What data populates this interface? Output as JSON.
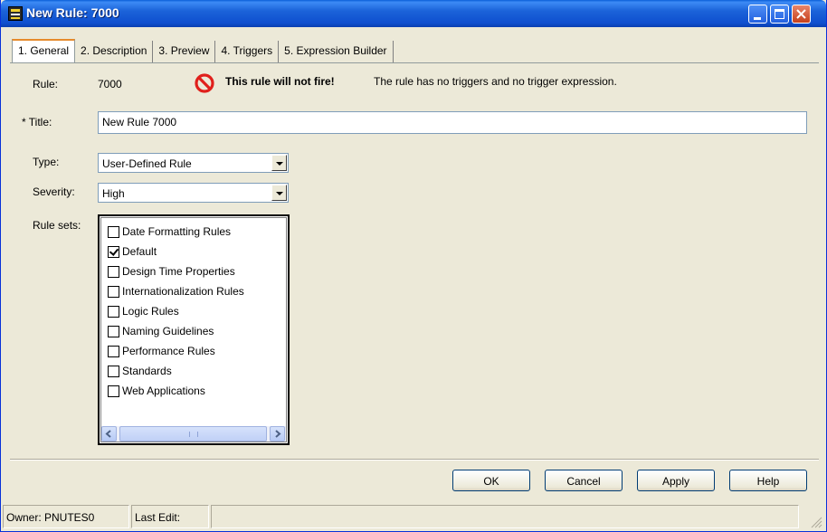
{
  "window": {
    "title": "New Rule: 7000"
  },
  "tabs": [
    {
      "label": "1. General"
    },
    {
      "label": "2. Description"
    },
    {
      "label": "3. Preview"
    },
    {
      "label": "4. Triggers"
    },
    {
      "label": "5. Expression Builder"
    }
  ],
  "general": {
    "rule_label": "Rule:",
    "rule_value": "7000",
    "warning_bold": "This rule will not fire!",
    "warning_text": "The rule has no triggers and no trigger expression.",
    "title_label": "* Title:",
    "title_value": "New Rule 7000",
    "type_label": "Type:",
    "type_value": "User-Defined Rule",
    "severity_label": "Severity:",
    "severity_value": "High",
    "rulesets_label": "Rule sets:",
    "rulesets": [
      {
        "label": "Date Formatting Rules",
        "checked": false
      },
      {
        "label": "Default",
        "checked": true
      },
      {
        "label": "Design Time Properties",
        "checked": false
      },
      {
        "label": "Internationalization Rules",
        "checked": false
      },
      {
        "label": "Logic Rules",
        "checked": false
      },
      {
        "label": "Naming Guidelines",
        "checked": false
      },
      {
        "label": "Performance Rules",
        "checked": false
      },
      {
        "label": "Standards",
        "checked": false
      },
      {
        "label": "Web Applications",
        "checked": false
      }
    ]
  },
  "buttons": {
    "ok": "OK",
    "cancel": "Cancel",
    "apply": "Apply",
    "help": "Help"
  },
  "status": {
    "owner": "Owner: PNUTES0",
    "last_edit": "Last Edit:"
  },
  "colors": {
    "titlebar": "#0f4fcf",
    "dialog_bg": "#ece9d8",
    "warning_icon": "#e0201c",
    "active_tab_accent": "#e68b2c"
  },
  "icons": {
    "app": "rule-app-icon",
    "warning": "no-entry-icon",
    "minimize": "minimize-icon",
    "maximize": "maximize-icon",
    "close": "close-icon"
  }
}
